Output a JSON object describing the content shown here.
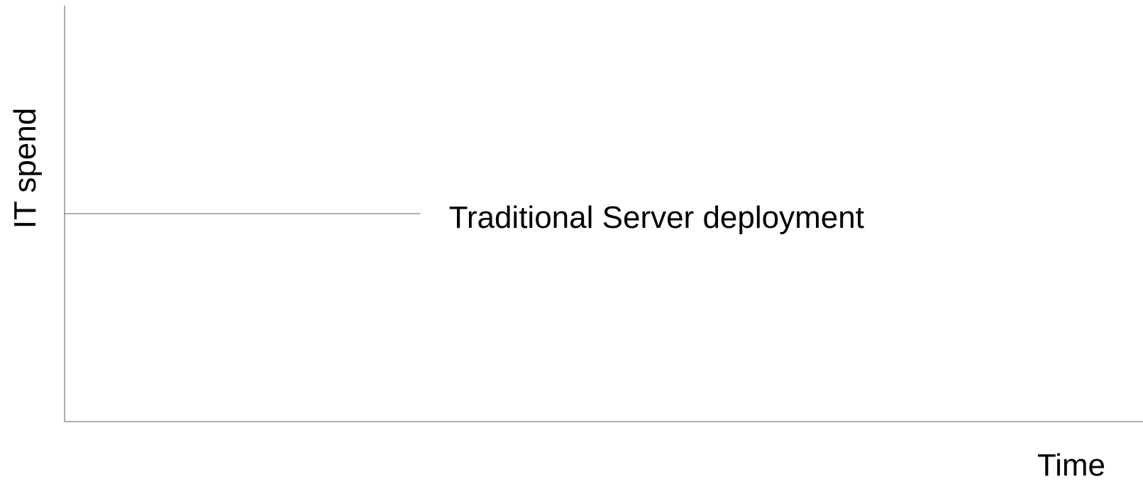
{
  "chart_data": {
    "type": "line",
    "title": "",
    "xlabel": "Time",
    "ylabel": "IT spend",
    "xlim": [
      0,
      100
    ],
    "ylim": [
      0,
      100
    ],
    "grid": false,
    "legend": "none",
    "series": [
      {
        "name": "Traditional Server deployment",
        "color": "#7f7f7f",
        "x": [
          0,
          33
        ],
        "y": [
          50,
          50
        ]
      }
    ]
  }
}
